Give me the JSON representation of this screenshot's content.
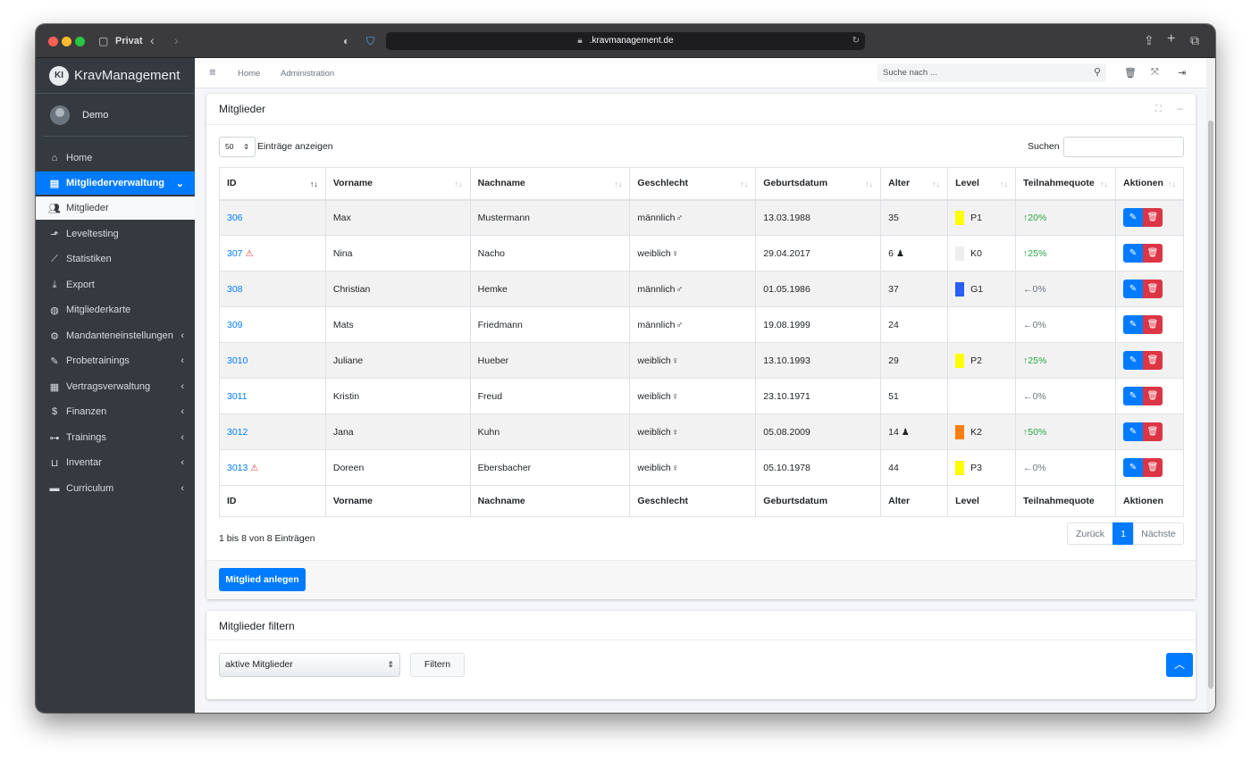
{
  "browser": {
    "profile_label": "Privat",
    "url": ".kravmanagement.de"
  },
  "sidebar": {
    "brand": "KravManagement",
    "logo_text": "KI",
    "user": "Demo",
    "items": [
      {
        "label": "Home",
        "icon": "home-icon"
      },
      {
        "label": "Mitgliederverwaltung",
        "icon": "address-book-icon",
        "active": true
      },
      {
        "label": "Mitglieder",
        "icon": "users-icon"
      },
      {
        "label": "Leveltesting",
        "icon": "level-up-icon"
      },
      {
        "label": "Statistiken",
        "icon": "chart-line-icon"
      },
      {
        "label": "Export",
        "icon": "download-icon"
      },
      {
        "label": "Mitgliederkarte",
        "icon": "globe-icon"
      },
      {
        "label": "Mandanteneinstellungen",
        "icon": "cogs-icon"
      },
      {
        "label": "Probetrainings",
        "icon": "wrench-icon"
      },
      {
        "label": "Vertragsverwaltung",
        "icon": "contract-icon"
      },
      {
        "label": "Finanzen",
        "icon": "hand-money-icon"
      },
      {
        "label": "Trainings",
        "icon": "dumbbell-icon"
      },
      {
        "label": "Inventar",
        "icon": "inventory-icon"
      },
      {
        "label": "Curriculum",
        "icon": "book-icon"
      }
    ]
  },
  "header": {
    "nav_home": "Home",
    "nav_admin": "Administration",
    "search_placeholder": "Suche nach ..."
  },
  "members_card": {
    "title": "Mitglieder",
    "length_value": "50",
    "length_label": "Einträge anzeigen",
    "search_label": "Suchen",
    "columns": [
      "ID",
      "Vorname",
      "Nachname",
      "Geschlecht",
      "Geburtsdatum",
      "Alter",
      "Level",
      "Teilnahmequote",
      "Aktionen"
    ],
    "rows": [
      {
        "id": "306",
        "vorname": "Max",
        "nachname": "Mustermann",
        "geschlecht": "männlich",
        "geburtsdatum": "13.03.1988",
        "alter": "35",
        "level": "P1",
        "level_color": "#ffff00",
        "quote": "20%",
        "trend": "up",
        "badge": false,
        "child": false
      },
      {
        "id": "307",
        "vorname": "Nina",
        "nachname": "Nacho",
        "geschlecht": "weiblich",
        "geburtsdatum": "29.04.2017",
        "alter": "6",
        "level": "K0",
        "level_color": "#eeeeee",
        "quote": "25%",
        "trend": "up",
        "badge": true,
        "child": true
      },
      {
        "id": "308",
        "vorname": "Christian",
        "nachname": "Hemke",
        "geschlecht": "männlich",
        "geburtsdatum": "01.05.1986",
        "alter": "37",
        "level": "G1",
        "level_color": "#2b5ef5",
        "quote": "0%",
        "trend": "flat",
        "badge": false,
        "child": false
      },
      {
        "id": "309",
        "vorname": "Mats",
        "nachname": "Friedmann",
        "geschlecht": "männlich",
        "geburtsdatum": "19.08.1999",
        "alter": "24",
        "level": "",
        "level_color": "",
        "quote": "0%",
        "trend": "flat",
        "badge": false,
        "child": false
      },
      {
        "id": "3010",
        "vorname": "Juliane",
        "nachname": "Hueber",
        "geschlecht": "weiblich",
        "geburtsdatum": "13.10.1993",
        "alter": "29",
        "level": "P2",
        "level_color": "#ffff00",
        "quote": "25%",
        "trend": "up",
        "badge": false,
        "child": false
      },
      {
        "id": "3011",
        "vorname": "Kristin",
        "nachname": "Freud",
        "geschlecht": "weiblich",
        "geburtsdatum": "23.10.1971",
        "alter": "51",
        "level": "",
        "level_color": "",
        "quote": "0%",
        "trend": "flat",
        "badge": false,
        "child": false
      },
      {
        "id": "3012",
        "vorname": "Jana",
        "nachname": "Kuhn",
        "geschlecht": "weiblich",
        "geburtsdatum": "05.08.2009",
        "alter": "14",
        "level": "K2",
        "level_color": "#ff7f0e",
        "quote": "50%",
        "trend": "up",
        "badge": false,
        "child": true
      },
      {
        "id": "3013",
        "vorname": "Doreen",
        "nachname": "Ebersbacher",
        "geschlecht": "weiblich",
        "geburtsdatum": "05.10.1978",
        "alter": "44",
        "level": "P3",
        "level_color": "#ffff00",
        "quote": "0%",
        "trend": "flat",
        "badge": true,
        "child": false
      }
    ],
    "info": "1 bis 8 von 8 Einträgen",
    "pagination": {
      "prev": "Zurück",
      "current": "1",
      "next": "Nächste"
    },
    "add_button": "Mitglied anlegen"
  },
  "filter_card": {
    "title": "Mitglieder filtern",
    "select_value": "aktive Mitglieder",
    "button": "Filtern"
  },
  "colors": {
    "accent": "#007bff",
    "danger": "#dc3545",
    "sidebar": "#343a40",
    "success": "#28a745"
  }
}
